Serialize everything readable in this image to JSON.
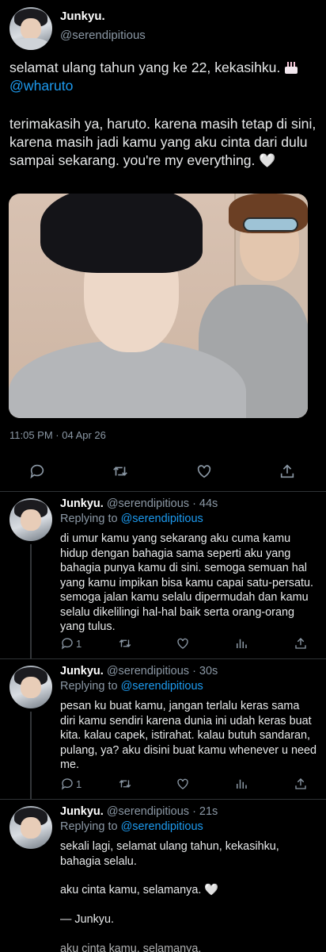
{
  "main_tweet": {
    "author_name": "Junkyu.",
    "author_handle": "@serendipitious",
    "text_line1": "selamat ulang tahun yang ke 22, kekasihku.",
    "mention": "@wharuto",
    "text_para2": "terimakasih ya, haruto. karena masih tetap di sini, karena masih jadi kamu yang aku cinta dari dulu sampai sekarang. you're my everything.",
    "heart_glyph": "🤍",
    "timestamp": "11:05 PM · 04 Apr 26",
    "actions": [
      "reply-icon",
      "retweet-icon",
      "like-icon",
      "share-icon"
    ]
  },
  "replies": [
    {
      "author_name": "Junkyu.",
      "author_handle": "@serendipitious",
      "time": "· 44s",
      "replying_prefix": "Replying to",
      "replying_to": "@serendipitious",
      "paragraphs": [
        "di umur kamu yang sekarang aku cuma kamu hidup dengan bahagia sama seperti aku yang bahagia punya kamu di sini. semoga semuan hal yang kamu impikan bisa kamu capai satu-persatu. semoga jalan kamu selalu dipermudah dan kamu selalu dikelilingi hal-hal baik serta orang-orang yang tulus."
      ],
      "reply_count": "1"
    },
    {
      "author_name": "Junkyu.",
      "author_handle": "@serendipitious",
      "time": "· 30s",
      "replying_prefix": "Replying to",
      "replying_to": "@serendipitious",
      "paragraphs": [
        "pesan ku buat kamu, jangan terlalu keras sama diri kamu sendiri karena dunia ini udah keras buat kita. kalau capek, istirahat. kalau butuh sandaran, pulang, ya? aku disini buat kamu whenever u need me."
      ],
      "reply_count": "1"
    },
    {
      "author_name": "Junkyu.",
      "author_handle": "@serendipitious",
      "time": "· 21s",
      "replying_prefix": "Replying to",
      "replying_to": "@serendipitious",
      "paragraphs": [
        "sekali lagi, selamat ulang tahun, kekasihku, bahagia selalu.",
        "aku cinta kamu, selamanya. 🤍",
        "— Junkyu."
      ]
    }
  ],
  "cutoff_text": "aku cinta kamu, selamanya.",
  "colors": {
    "background": "#000000",
    "text": "#e7e9ea",
    "secondary": "#8b98a5",
    "accent": "#1d9bf0",
    "divider": "#2f3336"
  }
}
